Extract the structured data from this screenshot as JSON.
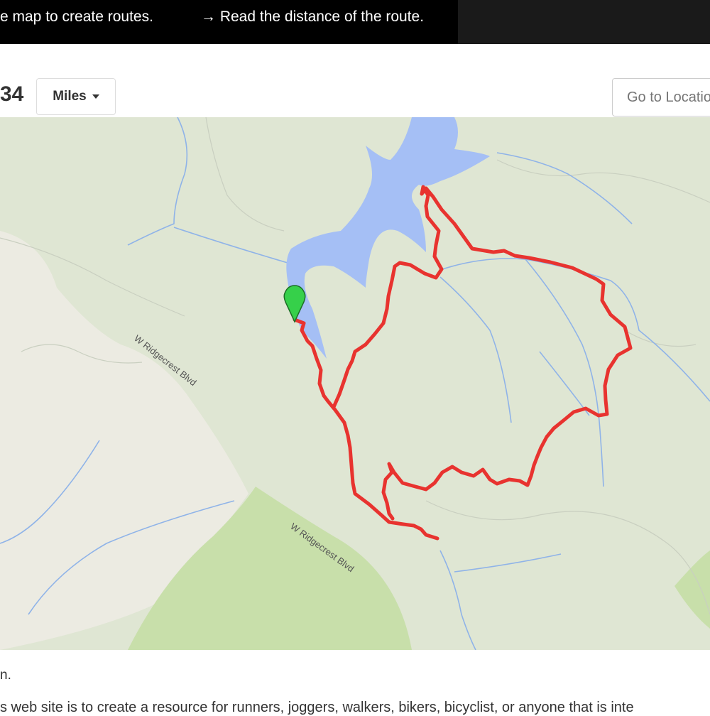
{
  "header": {
    "instruction_left": "e map to create routes.",
    "instruction_right": "→ Read the distance of the route."
  },
  "toolbar": {
    "distance_value": "34",
    "units_label": "Miles",
    "location_placeholder": "Go to Location"
  },
  "map": {
    "road_labels": [
      "W Ridgecrest Blvd",
      "W Ridgecrest Blvd"
    ],
    "marker": "start-marker",
    "route_color": "#e8332f",
    "water_color": "#a5bff5",
    "marker_color": "#36d04a"
  },
  "footer": {
    "caption": "n.",
    "paragraph": "s web site is to create a resource for runners, joggers, walkers, bikers, bicyclist, or anyone that is inte"
  }
}
